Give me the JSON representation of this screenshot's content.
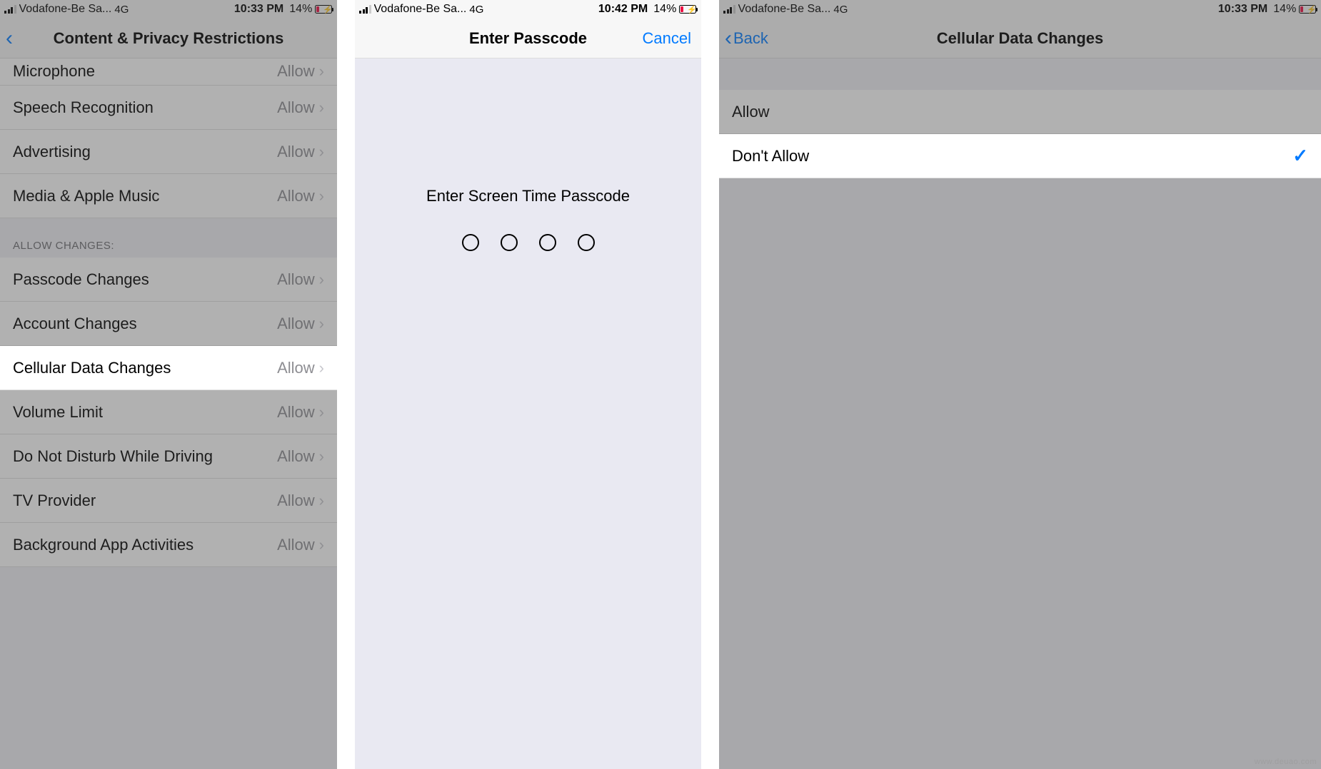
{
  "screens": [
    {
      "status": {
        "carrier": "Vodafone-Be Sa...",
        "net": "4G",
        "time": "10:33 PM",
        "battery": "14%"
      },
      "nav": {
        "title": "Content & Privacy Restrictions"
      },
      "partial_top": {
        "label": "Microphone",
        "value": "Allow"
      },
      "section1": [
        {
          "label": "Speech Recognition",
          "value": "Allow"
        },
        {
          "label": "Advertising",
          "value": "Allow"
        },
        {
          "label": "Media & Apple Music",
          "value": "Allow"
        }
      ],
      "section2_header": "ALLOW CHANGES:",
      "section2": [
        {
          "label": "Passcode Changes",
          "value": "Allow"
        },
        {
          "label": "Account Changes",
          "value": "Allow"
        },
        {
          "label": "Cellular Data Changes",
          "value": "Allow",
          "highlight": true
        },
        {
          "label": "Volume Limit",
          "value": "Allow"
        },
        {
          "label": "Do Not Disturb While Driving",
          "value": "Allow"
        },
        {
          "label": "TV Provider",
          "value": "Allow"
        },
        {
          "label": "Background App Activities",
          "value": "Allow"
        }
      ]
    },
    {
      "status": {
        "carrier": "Vodafone-Be Sa...",
        "net": "4G",
        "time": "10:42 PM",
        "battery": "14%"
      },
      "nav": {
        "title": "Enter Passcode",
        "right": "Cancel"
      },
      "prompt": "Enter Screen Time Passcode"
    },
    {
      "status": {
        "carrier": "Vodafone-Be Sa...",
        "net": "4G",
        "time": "10:33 PM",
        "battery": "14%"
      },
      "nav": {
        "title": "Cellular Data Changes",
        "back": "Back"
      },
      "options": [
        {
          "label": "Allow",
          "checked": false
        },
        {
          "label": "Don't Allow",
          "checked": true
        }
      ]
    }
  ],
  "watermark": "www.deuao.com"
}
